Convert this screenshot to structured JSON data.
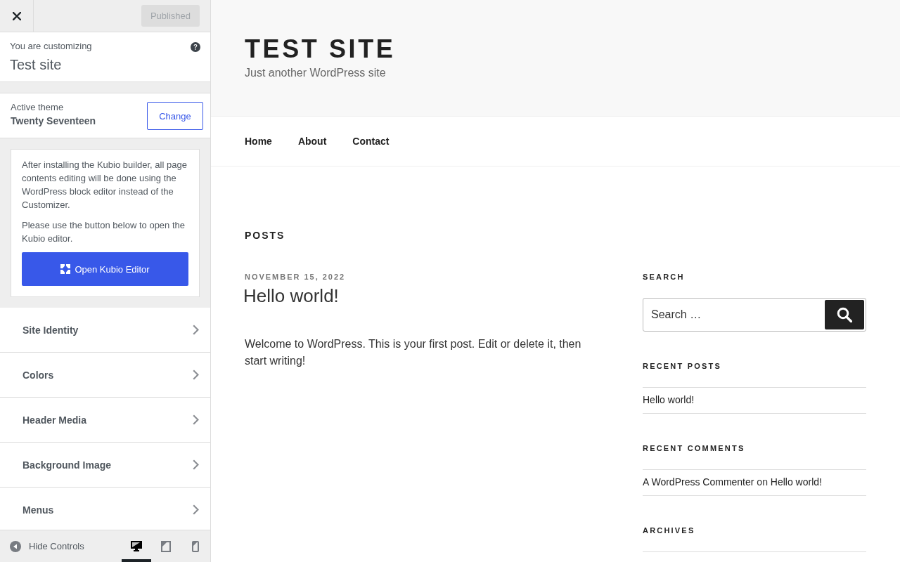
{
  "customizer": {
    "header": {
      "publish": {
        "label": "Published",
        "disabled": true
      }
    },
    "info": {
      "label": "You are customizing",
      "site_name": "Test site"
    },
    "theme": {
      "label": "Active theme",
      "name": "Twenty Seventeen",
      "button": "Change"
    },
    "notice": {
      "paragraphs": [
        "After installing the Kubio builder, all page contents editing will be done using the WordPress block editor instead of the Customizer.",
        "Please use the button below to open the Kubio editor."
      ],
      "button": "Open Kubio Editor"
    },
    "sections": [
      {
        "label": "Site Identity"
      },
      {
        "label": "Colors"
      },
      {
        "label": "Header Media"
      },
      {
        "label": "Background Image"
      },
      {
        "label": "Menus"
      }
    ],
    "footer": {
      "hide_controls": "Hide Controls",
      "devices": [
        {
          "kind": "desktop",
          "selected": true
        },
        {
          "kind": "tablet",
          "selected": false
        },
        {
          "kind": "mobile",
          "selected": false
        }
      ]
    }
  },
  "preview": {
    "site_title": "TEST SITE",
    "tagline": "Just another WordPress site",
    "nav": [
      {
        "label": "Home"
      },
      {
        "label": "About"
      },
      {
        "label": "Contact"
      }
    ],
    "page_title": "POSTS",
    "post": {
      "date": "NOVEMBER 15, 2022",
      "title": "Hello world!",
      "body": "Welcome to WordPress. This is your first post. Edit or delete it, then start writing!"
    },
    "widgets": [
      {
        "kind": "search",
        "title": "SEARCH",
        "placeholder": "Search …"
      },
      {
        "kind": "posts",
        "title": "RECENT POSTS",
        "items": [
          "Hello world!"
        ]
      },
      {
        "kind": "comments",
        "title": "RECENT COMMENTS",
        "items": [
          {
            "author": "A WordPress Commenter",
            "connector": "on",
            "post": "Hello world!"
          }
        ]
      },
      {
        "kind": "posts",
        "title": "ARCHIVES"
      }
    ]
  }
}
